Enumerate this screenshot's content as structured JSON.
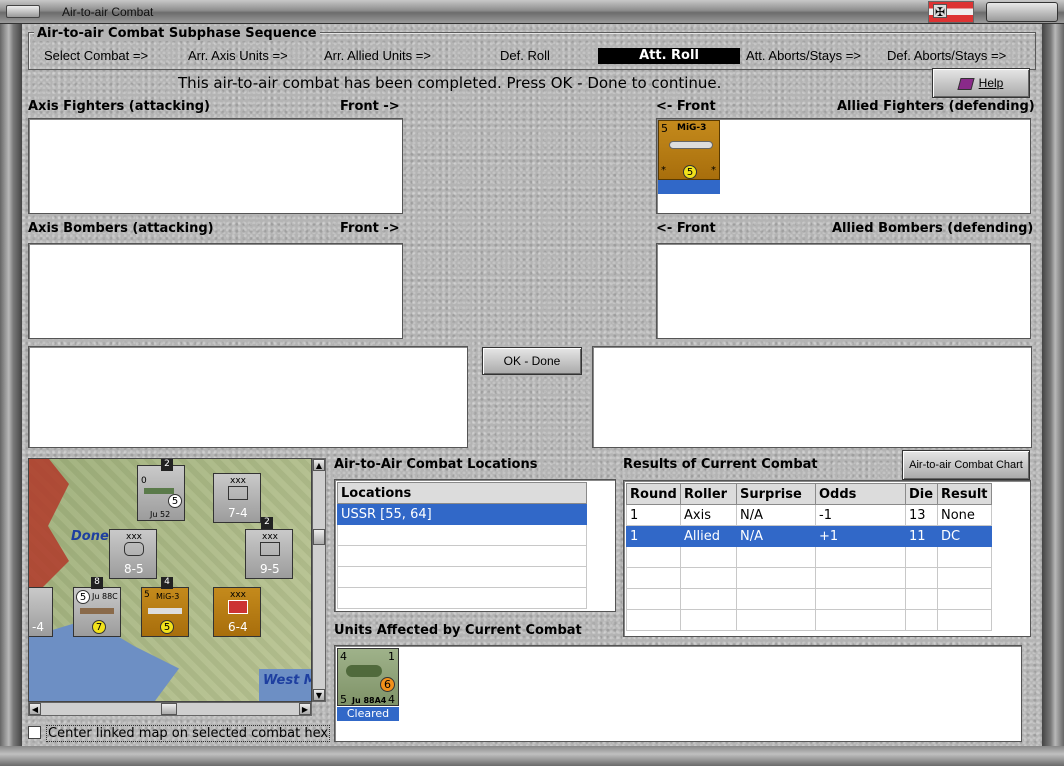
{
  "window": {
    "title": "Air-to-air Combat"
  },
  "sequence": {
    "heading": "Air-to-air Combat Subphase Sequence",
    "steps": [
      "Select Combat =>",
      "Arr. Axis Units =>",
      "Arr. Allied Units  =>",
      "Def. Roll",
      "Att. Roll",
      "Att. Aborts/Stays =>",
      "Def. Aborts/Stays =>"
    ],
    "active": "Att. Roll"
  },
  "status_message": "This air-to-air combat has been completed.  Press OK - Done to continue.",
  "help_label": "Help",
  "axis_fighters": {
    "label": "Axis Fighters (attacking)",
    "front": "Front ->"
  },
  "axis_bombers": {
    "label": "Axis Bombers (attacking)",
    "front": "Front ->"
  },
  "allied_fighters": {
    "label": "Allied Fighters (defending)",
    "front": "<- Front"
  },
  "allied_bombers": {
    "label": "Allied Bombers (defending)",
    "front": "<- Front"
  },
  "allied_fighter_unit": {
    "name": "MiG-3",
    "attack": "5",
    "defense": "5"
  },
  "ok_done_label": "OK - Done",
  "locations": {
    "heading": "Air-to-Air Combat Locations",
    "column": "Locations",
    "rows": [
      "USSR [55, 64]",
      "",
      "",
      "",
      "",
      ""
    ]
  },
  "results": {
    "heading": "Results of Current Combat",
    "chart_button": "Air-to-air Combat Chart",
    "columns": [
      "Round",
      "Roller",
      "Surprise",
      "Odds",
      "Die",
      "Result"
    ],
    "rows": [
      [
        "1",
        "Axis",
        "N/A",
        "-1",
        "13",
        "None"
      ],
      [
        "1",
        "Allied",
        "N/A",
        "+1",
        "11",
        "DC"
      ],
      [
        "",
        "",
        "",
        "",
        "",
        ""
      ],
      [
        "",
        "",
        "",
        "",
        "",
        ""
      ],
      [
        "",
        "",
        "",
        "",
        "",
        ""
      ],
      [
        "",
        "",
        "",
        "",
        "",
        ""
      ]
    ]
  },
  "units_affected": {
    "heading": "Units Affected by Current Combat",
    "unit": {
      "name": "Ju 88A4",
      "top_left": "4",
      "top_right": "1",
      "bottom_left": "5",
      "bottom_right": "4",
      "circle": "6",
      "status": "Cleared"
    }
  },
  "map": {
    "labels": {
      "done": "Done",
      "west": "West M"
    },
    "units": {
      "ju52": {
        "name": "Ju 52",
        "top": "0",
        "circle": "5",
        "stack": "2"
      },
      "inf74": {
        "size": "xxx",
        "value": "7-4"
      },
      "arm85": {
        "size": "xxx",
        "value": "8-5"
      },
      "inf95": {
        "size": "xxx",
        "value": "9-5",
        "stack": "2"
      },
      "ju88c": {
        "name": "Ju 88C",
        "top": "5",
        "circle": "7",
        "stack": "8"
      },
      "mig3": {
        "name": "MiG-3",
        "top": "5",
        "circle": "5",
        "stack": "4"
      },
      "sov64": {
        "size": "xxx",
        "value": "6-4"
      },
      "edge": {
        "value": "-4"
      }
    }
  },
  "center_map_checkbox": "Center linked map on selected combat hex"
}
